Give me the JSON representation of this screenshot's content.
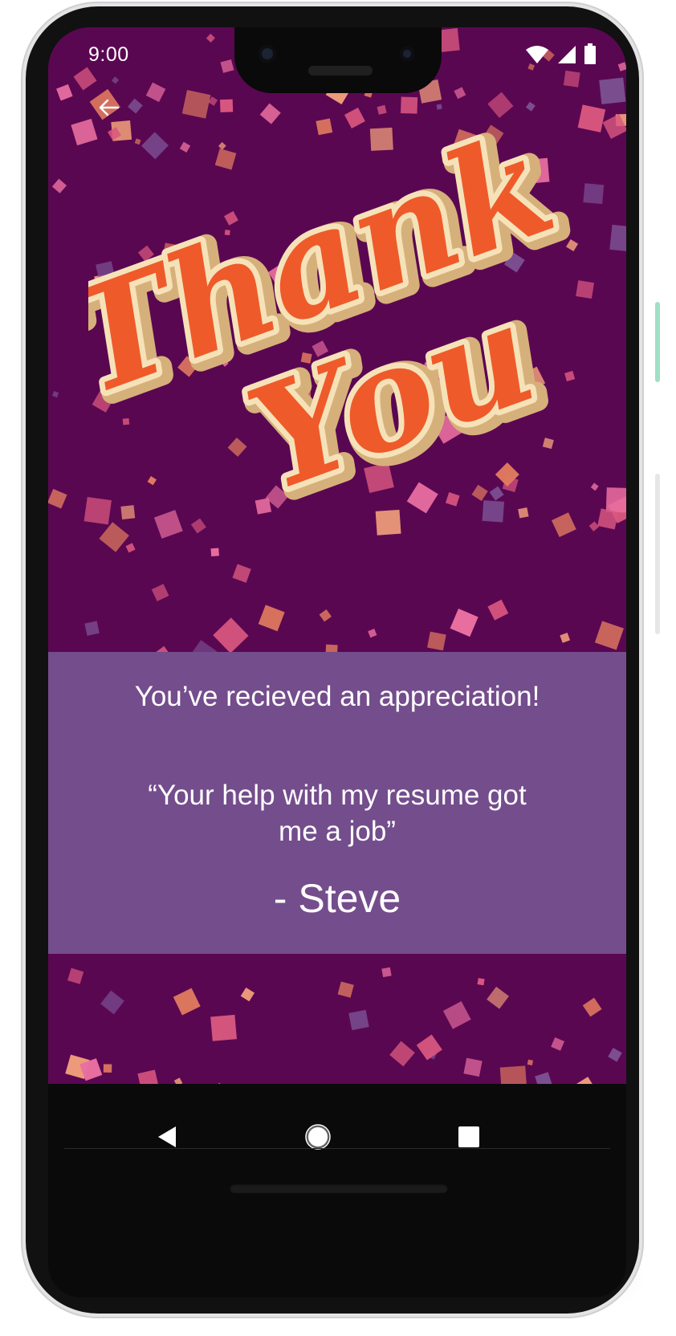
{
  "status_bar": {
    "time": "9:00",
    "icons": [
      "wifi-icon",
      "signal-icon",
      "battery-icon"
    ]
  },
  "toolbar": {
    "back_icon": "arrow-left-icon"
  },
  "hero": {
    "art_text_line1": "Thank",
    "art_text_line2": "You"
  },
  "appreciation": {
    "heading": "You’ve recieved an appreciation!",
    "message": "“Your help with my resume got me a job”",
    "sender": "- Steve"
  },
  "nav_bar": {
    "back": "triangle-back-icon",
    "home": "circle-home-icon",
    "recents": "square-recents-icon"
  },
  "colors": {
    "background": "#5a0752",
    "card": "#744d8c",
    "lettering": "#ef5a2a",
    "lettering_outline": "#f6e2b8",
    "confetti": [
      "#e07a5f",
      "#d9577f",
      "#7b4f92",
      "#f2a07b",
      "#ea6fa0"
    ]
  }
}
